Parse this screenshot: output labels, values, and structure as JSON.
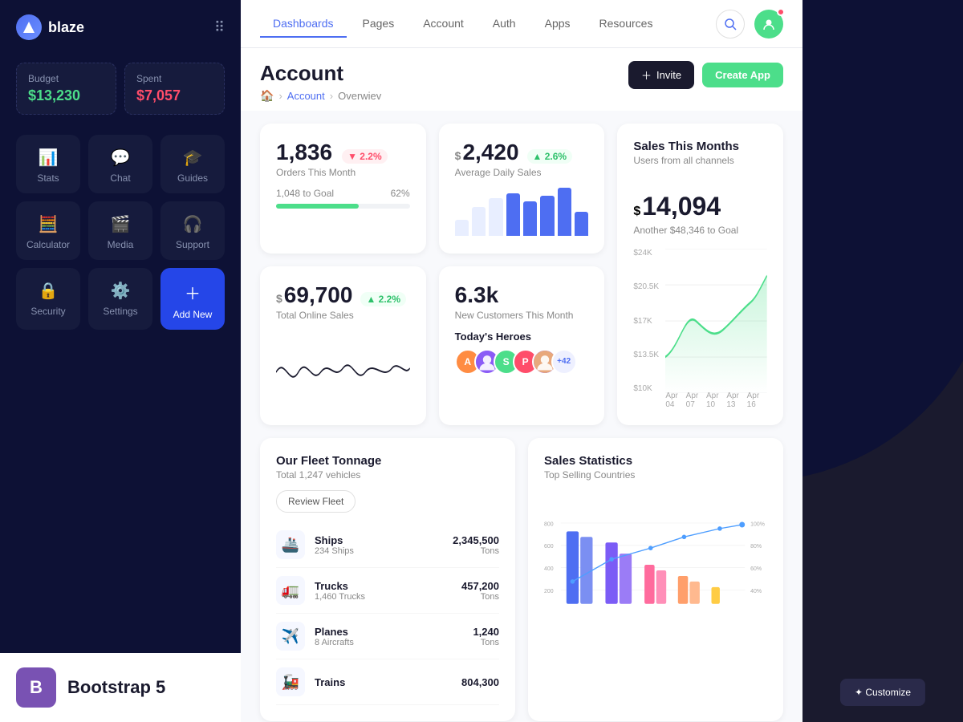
{
  "app": {
    "name": "blaze"
  },
  "sidebar": {
    "budget_label": "Budget",
    "budget_value": "$13,230",
    "spent_label": "Spent",
    "spent_value": "$7,057",
    "nav_items": [
      {
        "id": "stats",
        "label": "Stats",
        "icon": "📊"
      },
      {
        "id": "chat",
        "label": "Chat",
        "icon": "💬"
      },
      {
        "id": "guides",
        "label": "Guides",
        "icon": "🎓"
      },
      {
        "id": "calculator",
        "label": "Calculator",
        "icon": "🧮"
      },
      {
        "id": "media",
        "label": "Media",
        "icon": "🎬"
      },
      {
        "id": "support",
        "label": "Support",
        "icon": "🎧"
      },
      {
        "id": "security",
        "label": "Security",
        "icon": "🔒"
      },
      {
        "id": "settings",
        "label": "Settings",
        "icon": "⚙️"
      },
      {
        "id": "add-new",
        "label": "Add New",
        "icon": "+",
        "active": true
      }
    ],
    "bootstrap_label": "Bootstrap 5"
  },
  "topnav": {
    "tabs": [
      {
        "id": "dashboards",
        "label": "Dashboards",
        "active": true
      },
      {
        "id": "pages",
        "label": "Pages"
      },
      {
        "id": "account",
        "label": "Account"
      },
      {
        "id": "auth",
        "label": "Auth"
      },
      {
        "id": "apps",
        "label": "Apps"
      },
      {
        "id": "resources",
        "label": "Resources"
      }
    ]
  },
  "page": {
    "title": "Account",
    "breadcrumb_home": "🏠",
    "breadcrumb_link": "Account",
    "breadcrumb_current": "Overwiev",
    "invite_label": "Invite",
    "create_label": "Create App"
  },
  "stats": {
    "orders": {
      "value": "1,836",
      "badge": "▼ 2.2%",
      "badge_type": "down",
      "label": "Orders This Month",
      "progress_label": "1,048 to Goal",
      "progress_pct": "62%",
      "progress_val": 62
    },
    "daily_sales": {
      "prefix": "$",
      "value": "2,420",
      "badge": "▲ 2.6%",
      "badge_type": "up",
      "label": "Average Daily Sales",
      "bars": [
        30,
        55,
        70,
        80,
        65,
        75,
        90,
        45
      ]
    },
    "sales_month": {
      "title": "Sales This Months",
      "subtitle": "Users from all channels",
      "prefix": "$",
      "value": "14,094",
      "goal_text": "Another $48,346 to Goal",
      "y_labels": [
        "$24K",
        "$20.5K",
        "$17K",
        "$13.5K",
        "$10K"
      ],
      "x_labels": [
        "Apr 04",
        "Apr 07",
        "Apr 10",
        "Apr 13",
        "Apr 16"
      ]
    },
    "online_sales": {
      "prefix": "$",
      "value": "69,700",
      "badge": "▲ 2.2%",
      "badge_type": "up",
      "label": "Total Online Sales"
    },
    "customers": {
      "value": "6.3k",
      "label": "New Customers This Month",
      "heroes_title": "Today's Heroes",
      "heroes": [
        {
          "initial": "A",
          "color": "#ff8c42"
        },
        {
          "initial": "S",
          "color": "#4cde8a"
        },
        {
          "initial": "P",
          "color": "#ff4d6a"
        },
        {
          "initial": "more",
          "color": "#e8eeff",
          "text_color": "#4e6ef2",
          "label": "+42"
        }
      ]
    }
  },
  "fleet": {
    "title": "Our Fleet Tonnage",
    "subtitle": "Total 1,247 vehicles",
    "btn_label": "Review Fleet",
    "items": [
      {
        "icon": "🚢",
        "name": "Ships",
        "sub": "234 Ships",
        "value": "2,345,500",
        "unit": "Tons"
      },
      {
        "icon": "🚛",
        "name": "Trucks",
        "sub": "1,460 Trucks",
        "value": "457,200",
        "unit": "Tons"
      },
      {
        "icon": "✈️",
        "name": "Planes",
        "sub": "8 Aircrafts",
        "value": "1,240",
        "unit": "Tons"
      },
      {
        "icon": "🚂",
        "name": "Trains",
        "sub": "",
        "value": "804,300",
        "unit": ""
      }
    ]
  },
  "sales_statistics": {
    "title": "Sales Statistics",
    "subtitle": "Top Selling Countries",
    "y_labels": [
      "800",
      "600",
      "400",
      "200"
    ],
    "pct_labels": [
      "100%",
      "80%",
      "60%",
      "40%"
    ]
  },
  "customize": {
    "label": "✦ Customize"
  }
}
